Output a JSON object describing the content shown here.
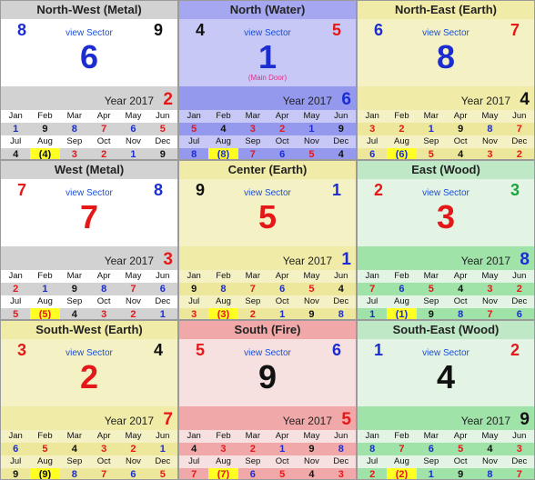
{
  "link_label": "view Sector",
  "year_label": "Year 2017",
  "main_door_label": "(Main Door)",
  "colors": {
    "red": "#e41818",
    "blue": "#1b2cd1",
    "green": "#17a63a",
    "black": "#111111"
  },
  "sectors": [
    {
      "title": "North-West (Metal)",
      "tl": "8",
      "tl_color": "blue",
      "tr": "9",
      "tr_color": "black",
      "center": "6",
      "center_color": "blue",
      "year_num": "2",
      "year_color": "red",
      "header_bg": "#d2d2d2",
      "body_bg": "#ffffff",
      "year_bg": "#d2d2d2",
      "row_light": "#ffffff",
      "row_dark": "#d2d2d2",
      "months1": [
        "Jan",
        "Feb",
        "Mar",
        "Apr",
        "May",
        "Jun"
      ],
      "vals1": [
        {
          "v": "1",
          "c": "blue"
        },
        {
          "v": "9",
          "c": "black"
        },
        {
          "v": "8",
          "c": "blue"
        },
        {
          "v": "7",
          "c": "red"
        },
        {
          "v": "6",
          "c": "blue"
        },
        {
          "v": "5",
          "c": "red"
        }
      ],
      "months2": [
        "Jul",
        "Aug",
        "Sep",
        "Oct",
        "Nov",
        "Dec"
      ],
      "vals2": [
        {
          "v": "4",
          "c": "black"
        },
        {
          "v": "(4)",
          "c": "black",
          "hl": true
        },
        {
          "v": "3",
          "c": "red"
        },
        {
          "v": "2",
          "c": "red"
        },
        {
          "v": "1",
          "c": "blue"
        },
        {
          "v": "9",
          "c": "black"
        }
      ]
    },
    {
      "title": "North (Water)",
      "tl": "4",
      "tl_color": "black",
      "tr": "5",
      "tr_color": "red",
      "center": "1",
      "center_color": "blue",
      "year_num": "6",
      "year_color": "blue",
      "main_door": true,
      "header_bg": "#a5a8f0",
      "body_bg": "#c7c8f5",
      "year_bg": "#9499ee",
      "row_light": "#c7c8f5",
      "row_dark": "#9499ee",
      "months1": [
        "Jan",
        "Feb",
        "Mar",
        "Apr",
        "May",
        "Jun"
      ],
      "vals1": [
        {
          "v": "5",
          "c": "red"
        },
        {
          "v": "4",
          "c": "black"
        },
        {
          "v": "3",
          "c": "red"
        },
        {
          "v": "2",
          "c": "red"
        },
        {
          "v": "1",
          "c": "blue"
        },
        {
          "v": "9",
          "c": "black"
        }
      ],
      "months2": [
        "Jul",
        "Aug",
        "Sep",
        "Oct",
        "Nov",
        "Dec"
      ],
      "vals2": [
        {
          "v": "8",
          "c": "blue"
        },
        {
          "v": "(8)",
          "c": "blue",
          "hl": true
        },
        {
          "v": "7",
          "c": "red"
        },
        {
          "v": "6",
          "c": "blue"
        },
        {
          "v": "5",
          "c": "red"
        },
        {
          "v": "4",
          "c": "black"
        }
      ]
    },
    {
      "title": "North-East (Earth)",
      "tl": "6",
      "tl_color": "blue",
      "tr": "7",
      "tr_color": "red",
      "center": "8",
      "center_color": "blue",
      "year_num": "4",
      "year_color": "black",
      "header_bg": "#f0eca8",
      "body_bg": "#f4f1c4",
      "year_bg": "#f0eca8",
      "row_light": "#f4f1c4",
      "row_dark": "#ece79a",
      "months1": [
        "Jan",
        "Feb",
        "Mar",
        "Apr",
        "May",
        "Jun"
      ],
      "vals1": [
        {
          "v": "3",
          "c": "red"
        },
        {
          "v": "2",
          "c": "red"
        },
        {
          "v": "1",
          "c": "blue"
        },
        {
          "v": "9",
          "c": "black"
        },
        {
          "v": "8",
          "c": "blue"
        },
        {
          "v": "7",
          "c": "red"
        }
      ],
      "months2": [
        "Jul",
        "Aug",
        "Sep",
        "Oct",
        "Nov",
        "Dec"
      ],
      "vals2": [
        {
          "v": "6",
          "c": "blue"
        },
        {
          "v": "(6)",
          "c": "blue",
          "hl": true
        },
        {
          "v": "5",
          "c": "red"
        },
        {
          "v": "4",
          "c": "black"
        },
        {
          "v": "3",
          "c": "red"
        },
        {
          "v": "2",
          "c": "red"
        }
      ]
    },
    {
      "title": "West (Metal)",
      "tl": "7",
      "tl_color": "red",
      "tr": "8",
      "tr_color": "blue",
      "center": "7",
      "center_color": "red",
      "year_num": "3",
      "year_color": "red",
      "header_bg": "#d2d2d2",
      "body_bg": "#ffffff",
      "year_bg": "#d2d2d2",
      "row_light": "#ffffff",
      "row_dark": "#d2d2d2",
      "months1": [
        "Jan",
        "Feb",
        "Mar",
        "Apr",
        "May",
        "Jun"
      ],
      "vals1": [
        {
          "v": "2",
          "c": "red"
        },
        {
          "v": "1",
          "c": "blue"
        },
        {
          "v": "9",
          "c": "black"
        },
        {
          "v": "8",
          "c": "blue"
        },
        {
          "v": "7",
          "c": "red"
        },
        {
          "v": "6",
          "c": "blue"
        }
      ],
      "months2": [
        "Jul",
        "Aug",
        "Sep",
        "Oct",
        "Nov",
        "Dec"
      ],
      "vals2": [
        {
          "v": "5",
          "c": "red"
        },
        {
          "v": "(5)",
          "c": "red",
          "hl": true
        },
        {
          "v": "4",
          "c": "black"
        },
        {
          "v": "3",
          "c": "red"
        },
        {
          "v": "2",
          "c": "red"
        },
        {
          "v": "1",
          "c": "blue"
        }
      ]
    },
    {
      "title": "Center (Earth)",
      "tl": "9",
      "tl_color": "black",
      "tr": "1",
      "tr_color": "blue",
      "center": "5",
      "center_color": "red",
      "year_num": "1",
      "year_color": "blue",
      "header_bg": "#f0eca8",
      "body_bg": "#f4f1c4",
      "year_bg": "#f0eca8",
      "row_light": "#f4f1c4",
      "row_dark": "#ece79a",
      "months1": [
        "Jan",
        "Feb",
        "Mar",
        "Apr",
        "May",
        "Jun"
      ],
      "vals1": [
        {
          "v": "9",
          "c": "black"
        },
        {
          "v": "8",
          "c": "blue"
        },
        {
          "v": "7",
          "c": "red"
        },
        {
          "v": "6",
          "c": "blue"
        },
        {
          "v": "5",
          "c": "red"
        },
        {
          "v": "4",
          "c": "black"
        }
      ],
      "months2": [
        "Jul",
        "Aug",
        "Sep",
        "Oct",
        "Nov",
        "Dec"
      ],
      "vals2": [
        {
          "v": "3",
          "c": "red"
        },
        {
          "v": "(3)",
          "c": "red",
          "hl": true
        },
        {
          "v": "2",
          "c": "red"
        },
        {
          "v": "1",
          "c": "blue"
        },
        {
          "v": "9",
          "c": "black"
        },
        {
          "v": "8",
          "c": "blue"
        }
      ]
    },
    {
      "title": "East (Wood)",
      "tl": "2",
      "tl_color": "red",
      "tr": "3",
      "tr_color": "green",
      "center": "3",
      "center_color": "red",
      "year_num": "8",
      "year_color": "blue",
      "header_bg": "#bfe8c6",
      "body_bg": "#e3f3e4",
      "year_bg": "#9fe3a8",
      "row_light": "#e3f3e4",
      "row_dark": "#9fe3a8",
      "months1": [
        "Jan",
        "Feb",
        "Mar",
        "Apr",
        "May",
        "Jun"
      ],
      "vals1": [
        {
          "v": "7",
          "c": "red"
        },
        {
          "v": "6",
          "c": "blue"
        },
        {
          "v": "5",
          "c": "red"
        },
        {
          "v": "4",
          "c": "black"
        },
        {
          "v": "3",
          "c": "red"
        },
        {
          "v": "2",
          "c": "red"
        }
      ],
      "months2": [
        "Jul",
        "Aug",
        "Sep",
        "Oct",
        "Nov",
        "Dec"
      ],
      "vals2": [
        {
          "v": "1",
          "c": "blue"
        },
        {
          "v": "(1)",
          "c": "blue",
          "hl": true
        },
        {
          "v": "9",
          "c": "black"
        },
        {
          "v": "8",
          "c": "blue"
        },
        {
          "v": "7",
          "c": "red"
        },
        {
          "v": "6",
          "c": "blue"
        }
      ]
    },
    {
      "title": "South-West (Earth)",
      "tl": "3",
      "tl_color": "red",
      "tr": "4",
      "tr_color": "black",
      "center": "2",
      "center_color": "red",
      "year_num": "7",
      "year_color": "red",
      "header_bg": "#f0eca8",
      "body_bg": "#f4f1c4",
      "year_bg": "#f0eca8",
      "row_light": "#f4f1c4",
      "row_dark": "#ece79a",
      "months1": [
        "Jan",
        "Feb",
        "Mar",
        "Apr",
        "May",
        "Jun"
      ],
      "vals1": [
        {
          "v": "6",
          "c": "blue"
        },
        {
          "v": "5",
          "c": "red"
        },
        {
          "v": "4",
          "c": "black"
        },
        {
          "v": "3",
          "c": "red"
        },
        {
          "v": "2",
          "c": "red"
        },
        {
          "v": "1",
          "c": "blue"
        }
      ],
      "months2": [
        "Jul",
        "Aug",
        "Sep",
        "Oct",
        "Nov",
        "Dec"
      ],
      "vals2": [
        {
          "v": "9",
          "c": "black"
        },
        {
          "v": "(9)",
          "c": "black",
          "hl": true
        },
        {
          "v": "8",
          "c": "blue"
        },
        {
          "v": "7",
          "c": "red"
        },
        {
          "v": "6",
          "c": "blue"
        },
        {
          "v": "5",
          "c": "red"
        }
      ]
    },
    {
      "title": "South (Fire)",
      "tl": "5",
      "tl_color": "red",
      "tr": "6",
      "tr_color": "blue",
      "center": "9",
      "center_color": "black",
      "year_num": "5",
      "year_color": "red",
      "header_bg": "#f0a8a8",
      "body_bg": "#f6e0e0",
      "year_bg": "#f0a8a8",
      "row_light": "#f6e0e0",
      "row_dark": "#f0a8a8",
      "months1": [
        "Jan",
        "Feb",
        "Mar",
        "Apr",
        "May",
        "Jun"
      ],
      "vals1": [
        {
          "v": "4",
          "c": "black"
        },
        {
          "v": "3",
          "c": "red"
        },
        {
          "v": "2",
          "c": "red"
        },
        {
          "v": "1",
          "c": "blue"
        },
        {
          "v": "9",
          "c": "black"
        },
        {
          "v": "8",
          "c": "blue"
        }
      ],
      "months2": [
        "Jul",
        "Aug",
        "Sep",
        "Oct",
        "Nov",
        "Dec"
      ],
      "vals2": [
        {
          "v": "7",
          "c": "red"
        },
        {
          "v": "(7)",
          "c": "red",
          "hl": true
        },
        {
          "v": "6",
          "c": "blue"
        },
        {
          "v": "5",
          "c": "red"
        },
        {
          "v": "4",
          "c": "black"
        },
        {
          "v": "3",
          "c": "red"
        }
      ]
    },
    {
      "title": "South-East (Wood)",
      "tl": "1",
      "tl_color": "blue",
      "tr": "2",
      "tr_color": "red",
      "center": "4",
      "center_color": "black",
      "year_num": "9",
      "year_color": "black",
      "header_bg": "#bfe8c6",
      "body_bg": "#e3f3e4",
      "year_bg": "#9fe3a8",
      "row_light": "#e3f3e4",
      "row_dark": "#9fe3a8",
      "months1": [
        "Jan",
        "Feb",
        "Mar",
        "Apr",
        "May",
        "Jun"
      ],
      "vals1": [
        {
          "v": "8",
          "c": "blue"
        },
        {
          "v": "7",
          "c": "red"
        },
        {
          "v": "6",
          "c": "blue"
        },
        {
          "v": "5",
          "c": "red"
        },
        {
          "v": "4",
          "c": "black"
        },
        {
          "v": "3",
          "c": "red"
        }
      ],
      "months2": [
        "Jul",
        "Aug",
        "Sep",
        "Oct",
        "Nov",
        "Dec"
      ],
      "vals2": [
        {
          "v": "2",
          "c": "red"
        },
        {
          "v": "(2)",
          "c": "red",
          "hl": true
        },
        {
          "v": "1",
          "c": "blue"
        },
        {
          "v": "9",
          "c": "black"
        },
        {
          "v": "8",
          "c": "blue"
        },
        {
          "v": "7",
          "c": "red"
        }
      ]
    }
  ]
}
